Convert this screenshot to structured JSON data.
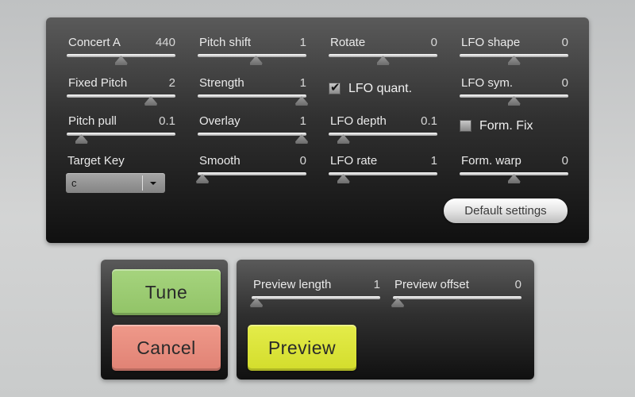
{
  "main_panel": {
    "sliders": [
      {
        "id": "concert-a",
        "label": "Concert A",
        "value": "440",
        "position": 0.5
      },
      {
        "id": "fixed-pitch",
        "label": "Fixed Pitch",
        "value": "2",
        "position": 0.8
      },
      {
        "id": "pitch-pull",
        "label": "Pitch pull",
        "value": "0.1",
        "position": 0.1
      },
      {
        "id": "pitch-shift",
        "label": "Pitch shift",
        "value": "1",
        "position": 0.54
      },
      {
        "id": "strength",
        "label": "Strength",
        "value": "1",
        "position": 1.0
      },
      {
        "id": "overlay",
        "label": "Overlay",
        "value": "1",
        "position": 1.0
      },
      {
        "id": "smooth",
        "label": "Smooth",
        "value": "0",
        "position": 0.0
      },
      {
        "id": "rotate",
        "label": "Rotate",
        "value": "0",
        "position": 0.5
      },
      {
        "id": "lfo-depth",
        "label": "LFO depth",
        "value": "0.1",
        "position": 0.1
      },
      {
        "id": "lfo-rate",
        "label": "LFO rate",
        "value": "1",
        "position": 0.1
      },
      {
        "id": "lfo-shape",
        "label": "LFO shape",
        "value": "0",
        "position": 0.5
      },
      {
        "id": "lfo-sym",
        "label": "LFO sym.",
        "value": "0",
        "position": 0.5
      },
      {
        "id": "form-warp",
        "label": "Form. warp",
        "value": "0",
        "position": 0.5
      }
    ],
    "checkboxes": [
      {
        "id": "lfo-quant",
        "label": "LFO quant.",
        "checked": true,
        "mark": "✔"
      },
      {
        "id": "form-fix",
        "label": "Form. Fix",
        "checked": false,
        "mark": ""
      }
    ],
    "target_key": {
      "label": "Target Key",
      "value": "c"
    },
    "default_settings_label": "Default settings"
  },
  "actions": {
    "tune_label": "Tune",
    "cancel_label": "Cancel"
  },
  "preview": {
    "sliders": [
      {
        "id": "preview-length",
        "label": "Preview length",
        "value": "1",
        "position": 0.0
      },
      {
        "id": "preview-offset",
        "label": "Preview offset",
        "value": "0",
        "position": 0.0
      }
    ],
    "preview_label": "Preview"
  }
}
